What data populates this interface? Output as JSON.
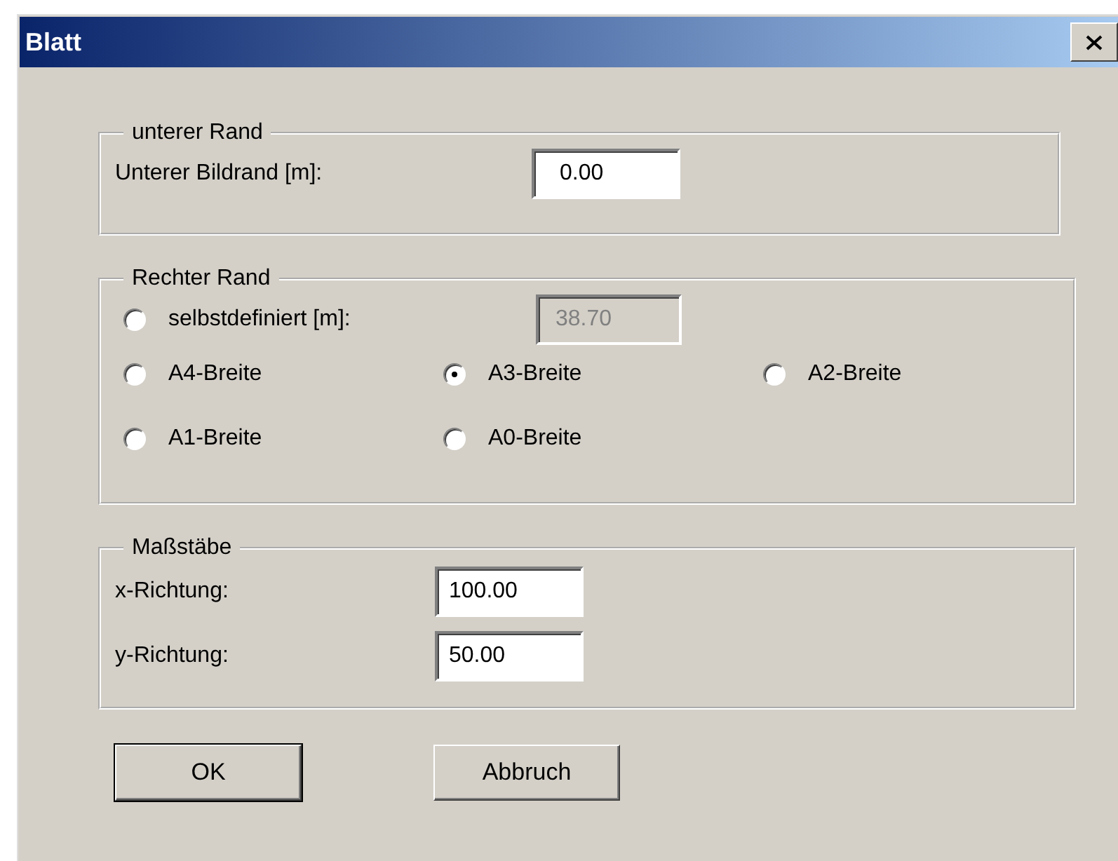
{
  "window": {
    "title": "Blatt"
  },
  "lower_margin": {
    "title": "unterer Rand",
    "label": "Unterer Bildrand [m]:",
    "value": "0.00"
  },
  "right_margin": {
    "title": "Rechter Rand",
    "options": [
      {
        "kind": "custom",
        "label": "selbstdefiniert [m]:",
        "selected": false,
        "value": "38.70",
        "disabled": true
      },
      {
        "kind": "plain",
        "label": "A4-Breite",
        "selected": false
      },
      {
        "kind": "plain",
        "label": "A3-Breite",
        "selected": true
      },
      {
        "kind": "plain",
        "label": "A2-Breite",
        "selected": false
      },
      {
        "kind": "plain",
        "label": "A1-Breite",
        "selected": false
      },
      {
        "kind": "plain",
        "label": "A0-Breite",
        "selected": false
      }
    ]
  },
  "scales": {
    "title": "Maßstäbe",
    "fields": [
      {
        "label": "x-Richtung:",
        "value": "100.00"
      },
      {
        "label": "y-Richtung:",
        "value": "50.00"
      }
    ]
  },
  "buttons": [
    {
      "label": "OK",
      "default": true
    },
    {
      "label": "Abbruch",
      "default": false
    }
  ]
}
